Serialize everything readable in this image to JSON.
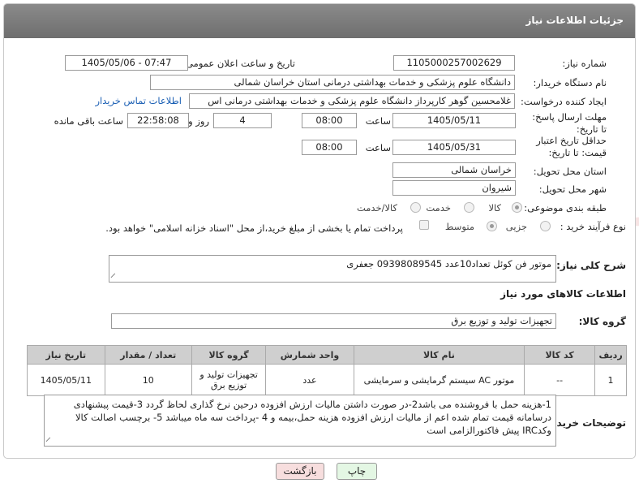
{
  "header": {
    "title": "جزئیات اطلاعات نیاز"
  },
  "fields": {
    "need_number_label": "شماره نیاز:",
    "need_number": "1105000257002629",
    "announce_label": "تاریخ و ساعت اعلان عمومی:",
    "announce_value": "1405/05/06 - 07:47",
    "buyer_org_label": "نام دستگاه خریدار:",
    "buyer_org": "دانشگاه علوم پزشکی و خدمات بهداشتی درمانی استان خراسان شمالی",
    "creator_label": "ایجاد کننده درخواست:",
    "creator": "غلامحسین گوهر کارپرداز  دانشگاه علوم پزشکی و خدمات بهداشتی درمانی اس",
    "contact_link": "اطلاعات تماس خریدار",
    "reply_deadline_label": "مهلت ارسال پاسخ: تا تاریخ:",
    "reply_date": "1405/05/11",
    "time_label": "ساعت",
    "reply_time": "08:00",
    "days_value": "4",
    "days_label": "روز و",
    "remaining_time": "22:58:08",
    "remaining_label": "ساعت باقی مانده",
    "price_validity_label": "حداقل تاریخ اعتبار قیمت: تا تاریخ:",
    "price_date": "1405/05/31",
    "price_time": "08:00",
    "province_label": "استان محل تحویل:",
    "province": "خراسان شمالی",
    "city_label": "شهر محل تحویل:",
    "city": "شیروان",
    "category_label": "طبقه بندی موضوعی:",
    "category_options": [
      "کالا",
      "خدمت",
      "کالا/خدمت"
    ],
    "process_label": "نوع فرآیند خرید :",
    "process_options": [
      "جزیی",
      "متوسط"
    ],
    "payment_note": "پرداخت تمام یا بخشی از مبلغ خرید،از محل \"اسناد خزانه اسلامی\" خواهد بود."
  },
  "description": {
    "label": "شرح کلی نیاز:",
    "value": "موتور فن کوئل تعداد10عدد 09398089545 جعفری"
  },
  "goods": {
    "section_title": "اطلاعات کالاهای مورد نیاز",
    "group_label": "گروه کالا:",
    "group_value": "تجهیزات تولید و توزیع برق",
    "columns": [
      "ردیف",
      "کد کالا",
      "نام کالا",
      "واحد شمارش",
      "گروه کالا",
      "تعداد / مقدار",
      "تاریخ نیاز"
    ],
    "rows": [
      [
        "1",
        "--",
        "موتور AC سیستم گرمایشی و سرمایشی",
        "عدد",
        "تجهیزات تولید و توزیع برق",
        "10",
        "1405/05/11"
      ]
    ]
  },
  "buyer_notes": {
    "label": "توضیحات خریدار:",
    "value": "1-هزینه حمل با فروشنده می باشد2-در صورت داشتن مالیات ارزش افزوده درحین نرخ گذاری لحاظ گردد 3-قیمت پیشنهادی درسامانه  قیمت تمام شده اعم از مالیات ارزش افزوده هزینه حمل،بیمه و 4 -پرداخت سه ماه میباشد 5- برچسب اصالت کالا وکدIRC پیش فاکتورالزامی است"
  },
  "buttons": {
    "print": "چاپ",
    "back": "بازگشت"
  },
  "watermark": {
    "text": "AriaTender.neT"
  },
  "colors": {
    "header_bg": "#7a7a7a",
    "link": "#1a5fb4",
    "back_button_bg": "#f7dede",
    "print_button_bg": "#e4f7e4",
    "watermark": "#f0c8c8"
  }
}
